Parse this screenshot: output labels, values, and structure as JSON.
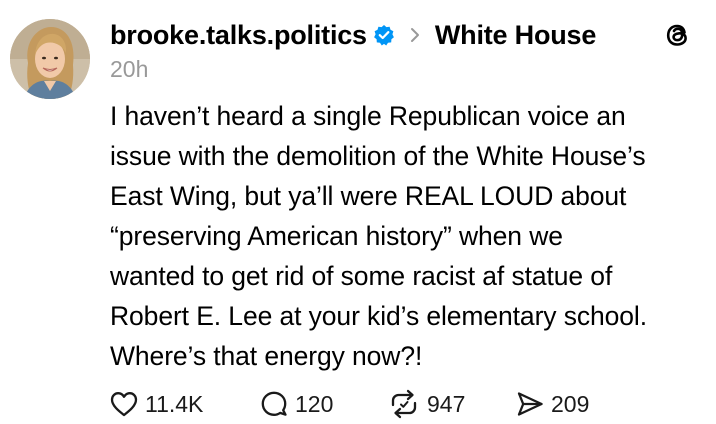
{
  "post": {
    "author": {
      "username": "brooke.talks.politics",
      "verified_icon": "verified-badge-icon",
      "avatar_icon": "profile-photo"
    },
    "topic": "White House",
    "separator_icon": "chevron-right-icon",
    "app_icon": "threads-logo-icon",
    "timestamp": "20h",
    "body_lines": [
      "I haven’t heard a single Republican voice an",
      "issue with the demolition of the White House’s",
      "East Wing, but ya’ll were REAL LOUD about",
      "“preserving American history” when we",
      "wanted to get rid of some racist af statue of",
      "Robert E. Lee at your kid’s elementary school.",
      "Where’s that energy now?!"
    ],
    "actions": {
      "likes": {
        "icon": "heart-icon",
        "count": "11.4K"
      },
      "replies": {
        "icon": "comment-icon",
        "count": "120"
      },
      "reposts": {
        "icon": "repost-icon",
        "count": "947"
      },
      "shares": {
        "icon": "send-icon",
        "count": "209"
      }
    }
  },
  "colors": {
    "text": "#000000",
    "muted": "#999999",
    "verified": "#0095f6"
  }
}
